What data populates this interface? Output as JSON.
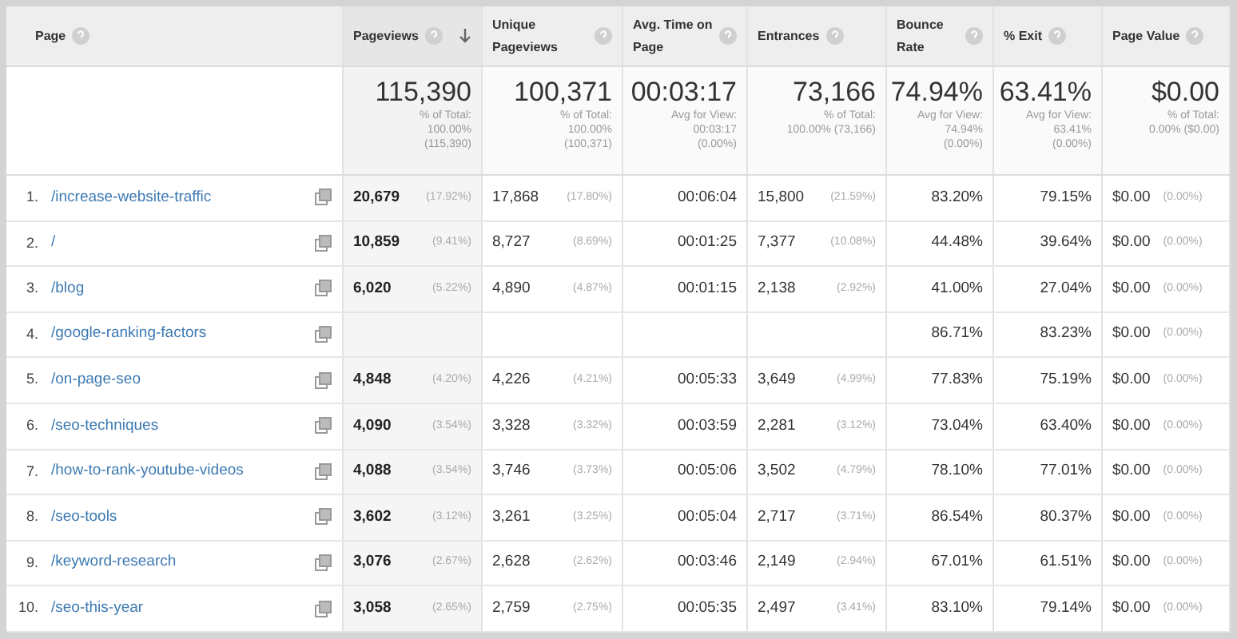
{
  "columns": [
    {
      "label": "Page",
      "sorted": false
    },
    {
      "label": "Pageviews",
      "sorted": true
    },
    {
      "label": "Unique Pageviews",
      "sorted": false
    },
    {
      "label": "Avg. Time on Page",
      "sorted": false
    },
    {
      "label": "Entrances",
      "sorted": false
    },
    {
      "label": "Bounce Rate",
      "sorted": false
    },
    {
      "label": "% Exit",
      "sorted": false
    },
    {
      "label": "Page Value",
      "sorted": false
    }
  ],
  "totals": [
    {
      "value": "115,390",
      "lines": [
        "% of Total:",
        "100.00%",
        "(115,390)"
      ]
    },
    {
      "value": "100,371",
      "lines": [
        "% of Total:",
        "100.00%",
        "(100,371)"
      ]
    },
    {
      "value": "00:03:17",
      "lines": [
        "Avg for View:",
        "00:03:17",
        "(0.00%)"
      ]
    },
    {
      "value": "73,166",
      "lines": [
        "% of Total:",
        "100.00% (73,166)"
      ]
    },
    {
      "value": "74.94%",
      "lines": [
        "Avg for View:",
        "74.94%",
        "(0.00%)"
      ]
    },
    {
      "value": "63.41%",
      "lines": [
        "Avg for View:",
        "63.41%",
        "(0.00%)"
      ]
    },
    {
      "value": "$0.00",
      "lines": [
        "% of Total:",
        "0.00% ($0.00)"
      ]
    }
  ],
  "rows": [
    {
      "rank": "1.",
      "page": "/increase-website-traffic",
      "cells": [
        {
          "value": "20,679",
          "pct": "(17.92%)"
        },
        {
          "value": "17,868",
          "pct": "(17.80%)"
        },
        {
          "value": "00:06:04"
        },
        {
          "value": "15,800",
          "pct": "(21.59%)"
        },
        {
          "value": "83.20%"
        },
        {
          "value": "79.15%"
        },
        {
          "value": "$0.00",
          "pct": "(0.00%)"
        }
      ]
    },
    {
      "rank": "2.",
      "page": "/",
      "cells": [
        {
          "value": "10,859",
          "pct": "(9.41%)"
        },
        {
          "value": "8,727",
          "pct": "(8.69%)"
        },
        {
          "value": "00:01:25"
        },
        {
          "value": "7,377",
          "pct": "(10.08%)"
        },
        {
          "value": "44.48%"
        },
        {
          "value": "39.64%"
        },
        {
          "value": "$0.00",
          "pct": "(0.00%)"
        }
      ]
    },
    {
      "rank": "3.",
      "page": "/blog",
      "cells": [
        {
          "value": "6,020",
          "pct": "(5.22%)"
        },
        {
          "value": "4,890",
          "pct": "(4.87%)"
        },
        {
          "value": "00:01:15"
        },
        {
          "value": "2,138",
          "pct": "(2.92%)"
        },
        {
          "value": "41.00%"
        },
        {
          "value": "27.04%"
        },
        {
          "value": "$0.00",
          "pct": "(0.00%)"
        }
      ]
    },
    {
      "rank": "4.",
      "page": "/google-ranking-factors",
      "cells": [
        {},
        {},
        {},
        {},
        {
          "value": "86.71%"
        },
        {
          "value": "83.23%"
        },
        {
          "value": "$0.00",
          "pct": "(0.00%)"
        }
      ]
    },
    {
      "rank": "5.",
      "page": "/on-page-seo",
      "cells": [
        {
          "value": "4,848",
          "pct": "(4.20%)"
        },
        {
          "value": "4,226",
          "pct": "(4.21%)"
        },
        {
          "value": "00:05:33"
        },
        {
          "value": "3,649",
          "pct": "(4.99%)"
        },
        {
          "value": "77.83%"
        },
        {
          "value": "75.19%"
        },
        {
          "value": "$0.00",
          "pct": "(0.00%)"
        }
      ]
    },
    {
      "rank": "6.",
      "page": "/seo-techniques",
      "cells": [
        {
          "value": "4,090",
          "pct": "(3.54%)"
        },
        {
          "value": "3,328",
          "pct": "(3.32%)"
        },
        {
          "value": "00:03:59"
        },
        {
          "value": "2,281",
          "pct": "(3.12%)"
        },
        {
          "value": "73.04%"
        },
        {
          "value": "63.40%"
        },
        {
          "value": "$0.00",
          "pct": "(0.00%)"
        }
      ]
    },
    {
      "rank": "7.",
      "page": "/how-to-rank-youtube-videos",
      "cells": [
        {
          "value": "4,088",
          "pct": "(3.54%)"
        },
        {
          "value": "3,746",
          "pct": "(3.73%)"
        },
        {
          "value": "00:05:06"
        },
        {
          "value": "3,502",
          "pct": "(4.79%)"
        },
        {
          "value": "78.10%"
        },
        {
          "value": "77.01%"
        },
        {
          "value": "$0.00",
          "pct": "(0.00%)"
        }
      ]
    },
    {
      "rank": "8.",
      "page": "/seo-tools",
      "cells": [
        {
          "value": "3,602",
          "pct": "(3.12%)"
        },
        {
          "value": "3,261",
          "pct": "(3.25%)"
        },
        {
          "value": "00:05:04"
        },
        {
          "value": "2,717",
          "pct": "(3.71%)"
        },
        {
          "value": "86.54%"
        },
        {
          "value": "80.37%"
        },
        {
          "value": "$0.00",
          "pct": "(0.00%)"
        }
      ]
    },
    {
      "rank": "9.",
      "page": "/keyword-research",
      "cells": [
        {
          "value": "3,076",
          "pct": "(2.67%)"
        },
        {
          "value": "2,628",
          "pct": "(2.62%)"
        },
        {
          "value": "00:03:46"
        },
        {
          "value": "2,149",
          "pct": "(2.94%)"
        },
        {
          "value": "67.01%"
        },
        {
          "value": "61.51%"
        },
        {
          "value": "$0.00",
          "pct": "(0.00%)"
        }
      ]
    },
    {
      "rank": "10.",
      "page": "/seo-this-year",
      "cells": [
        {
          "value": "3,058",
          "pct": "(2.65%)"
        },
        {
          "value": "2,759",
          "pct": "(2.75%)"
        },
        {
          "value": "00:05:35"
        },
        {
          "value": "2,497",
          "pct": "(3.41%)"
        },
        {
          "value": "83.10%"
        },
        {
          "value": "79.14%"
        },
        {
          "value": "$0.00",
          "pct": "(0.00%)"
        }
      ]
    }
  ]
}
